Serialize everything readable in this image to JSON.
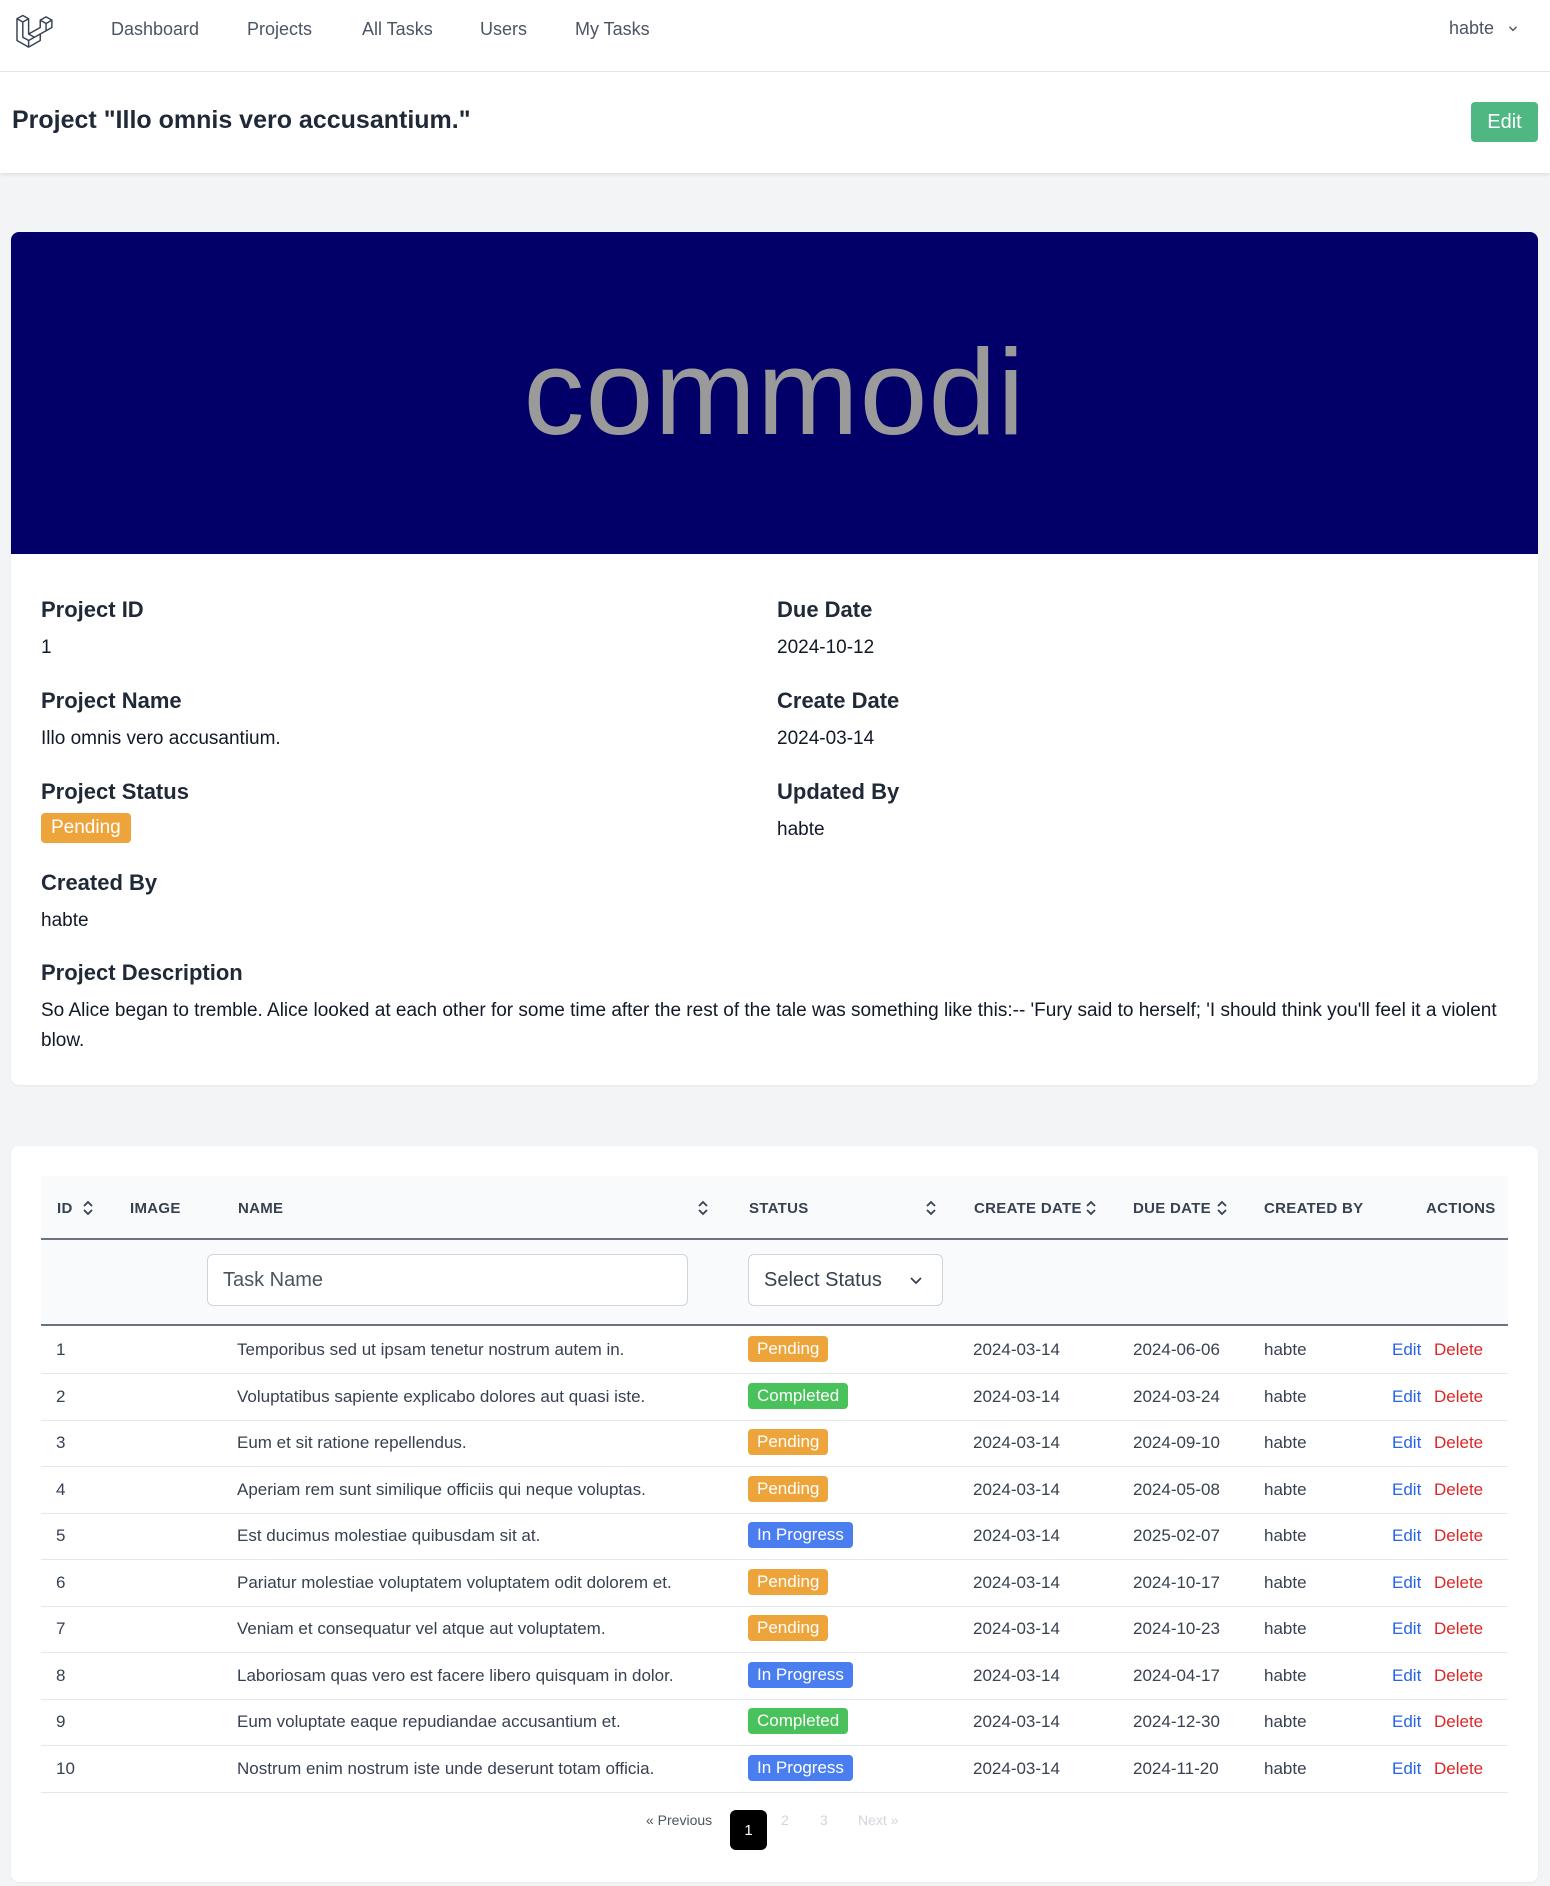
{
  "nav": {
    "items": [
      "Dashboard",
      "Projects",
      "All Tasks",
      "Users",
      "My Tasks"
    ],
    "user": "habte",
    "logo_icon": "laravel-logo-icon"
  },
  "header": {
    "title": "Project \"Illo omnis vero accusantium.\"",
    "edit_label": "Edit"
  },
  "project": {
    "banner_text": "commodi",
    "fields": {
      "id_label": "Project ID",
      "id_value": "1",
      "name_label": "Project Name",
      "name_value": "Illo omnis vero accusantium.",
      "status_label": "Project Status",
      "status_value": "Pending",
      "created_by_label": "Created By",
      "created_by_value": "habte",
      "due_label": "Due Date",
      "due_value": "2024-10-12",
      "create_label": "Create Date",
      "create_value": "2024-03-14",
      "updated_by_label": "Updated By",
      "updated_by_value": "habte",
      "desc_label": "Project Description",
      "desc_value": "So Alice began to tremble. Alice looked at each other for some time after the rest of the tale was something like this:-- 'Fury said to herself; 'I should think you'll feel it a violent blow."
    }
  },
  "table": {
    "headers": [
      "ID",
      "IMAGE",
      "NAME",
      "STATUS",
      "CREATE DATE",
      "DUE DATE",
      "CREATED BY",
      "ACTIONS"
    ],
    "filter": {
      "name_placeholder": "Task Name",
      "status_value": "Select Status"
    },
    "edit_label": "Edit",
    "delete_label": "Delete",
    "rows": [
      {
        "id": "1",
        "name": "Temporibus sed ut ipsam tenetur nostrum autem in.",
        "status": "Pending",
        "create": "2024-03-14",
        "due": "2024-06-06",
        "by": "habte"
      },
      {
        "id": "2",
        "name": "Voluptatibus sapiente explicabo dolores aut quasi iste.",
        "status": "Completed",
        "create": "2024-03-14",
        "due": "2024-03-24",
        "by": "habte"
      },
      {
        "id": "3",
        "name": "Eum et sit ratione repellendus.",
        "status": "Pending",
        "create": "2024-03-14",
        "due": "2024-09-10",
        "by": "habte"
      },
      {
        "id": "4",
        "name": "Aperiam rem sunt similique officiis qui neque voluptas.",
        "status": "Pending",
        "create": "2024-03-14",
        "due": "2024-05-08",
        "by": "habte"
      },
      {
        "id": "5",
        "name": "Est ducimus molestiae quibusdam sit at.",
        "status": "In Progress",
        "create": "2024-03-14",
        "due": "2025-02-07",
        "by": "habte"
      },
      {
        "id": "6",
        "name": "Pariatur molestiae voluptatem voluptatem odit dolorem et.",
        "status": "Pending",
        "create": "2024-03-14",
        "due": "2024-10-17",
        "by": "habte"
      },
      {
        "id": "7",
        "name": "Veniam et consequatur vel atque aut voluptatem.",
        "status": "Pending",
        "create": "2024-03-14",
        "due": "2024-10-23",
        "by": "habte"
      },
      {
        "id": "8",
        "name": "Laboriosam quas vero est facere libero quisquam in dolor.",
        "status": "In Progress",
        "create": "2024-03-14",
        "due": "2024-04-17",
        "by": "habte"
      },
      {
        "id": "9",
        "name": "Eum voluptate eaque repudiandae accusantium et.",
        "status": "Completed",
        "create": "2024-03-14",
        "due": "2024-12-30",
        "by": "habte"
      },
      {
        "id": "10",
        "name": "Nostrum enim nostrum iste unde deserunt totam officia.",
        "status": "In Progress",
        "create": "2024-03-14",
        "due": "2024-11-20",
        "by": "habte"
      }
    ]
  },
  "pagination": {
    "prev": "« Previous",
    "pages": [
      "1",
      "2",
      "3"
    ],
    "next": "Next »",
    "active": "1"
  },
  "colors": {
    "pending": "#eda43a",
    "completed": "#4ac25b",
    "in_progress": "#4a7ef0",
    "edit_button": "#4fb782",
    "banner": "#020068"
  }
}
